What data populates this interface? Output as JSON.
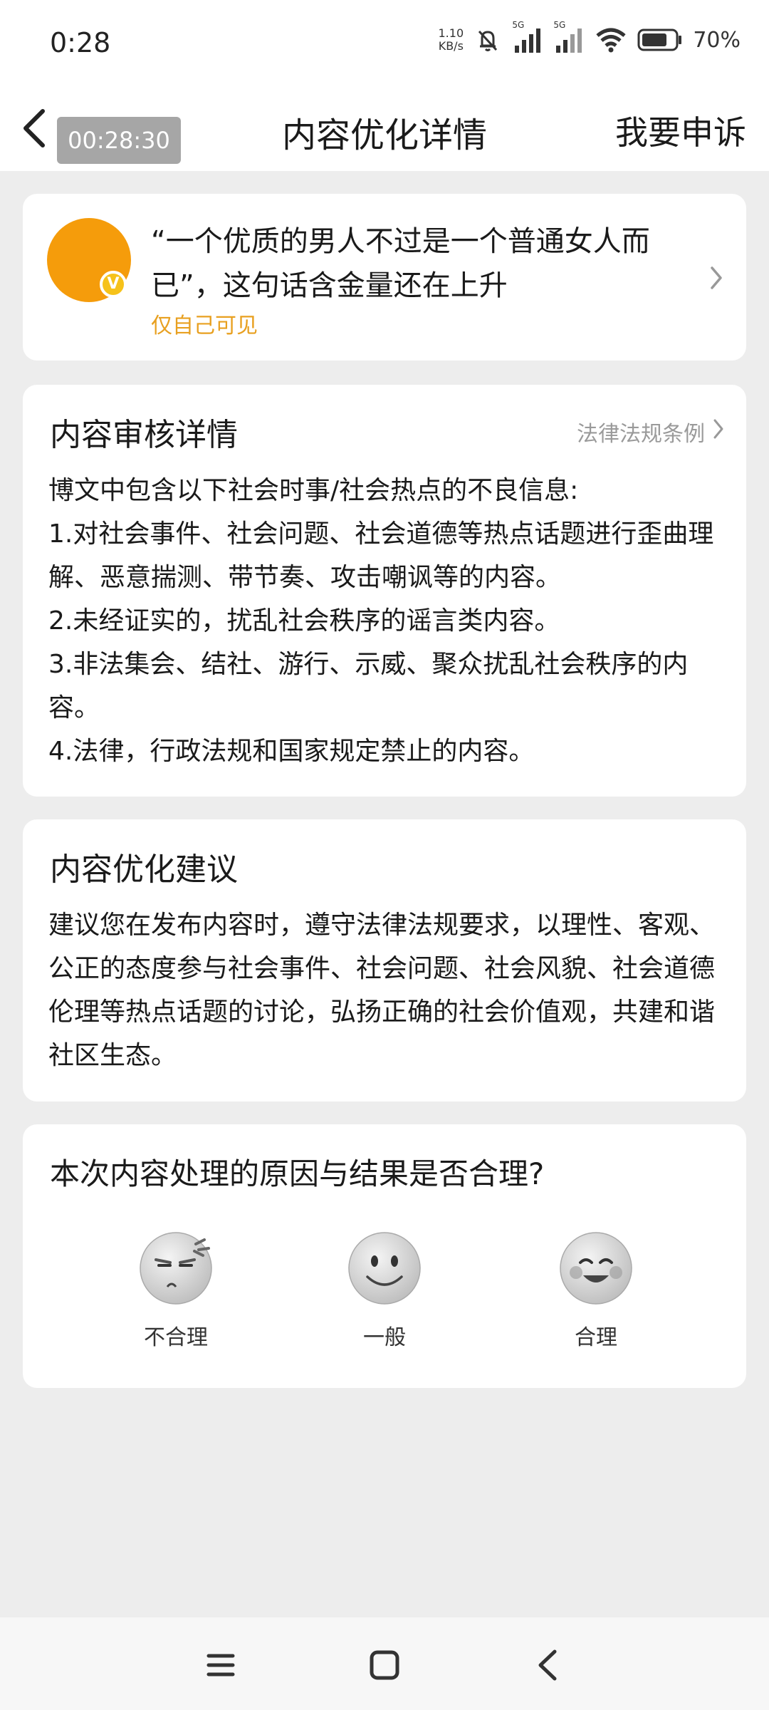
{
  "status_bar": {
    "time": "0:28",
    "net_speed_value": "1.10",
    "net_speed_unit": "KB/s",
    "signal1_label": "5G",
    "signal2_label": "5G",
    "battery_percent": "70%"
  },
  "header": {
    "timer": "00:28:30",
    "title": "内容优化详情",
    "appeal_label": "我要申诉",
    "back_icon": "chevron-left-icon"
  },
  "post": {
    "text": "“一个优质的男人不过是一个普通女人而已”，这句话含金量还在上升",
    "visibility": "仅自己可见",
    "avatar_color": "#f59c0b",
    "badge_text": "V"
  },
  "review": {
    "title": "内容审核详情",
    "law_link": "法律法规条例",
    "intro": "博文中包含以下社会时事/社会热点的不良信息:",
    "items": [
      "1.对社会事件、社会问题、社会道德等热点话题进行歪曲理解、恶意揣测、带节奏、攻击嘲讽等的内容。",
      "2.未经证实的，扰乱社会秩序的谣言类内容。",
      "3.非法集会、结社、游行、示威、聚众扰乱社会秩序的内容。",
      "4.法律，行政法规和国家规定禁止的内容。"
    ]
  },
  "suggestion": {
    "title": "内容优化建议",
    "body": "建议您在发布内容时，遵守法律法规要求，以理性、客观、公正的态度参与社会事件、社会问题、社会风貌、社会道德伦理等热点话题的讨论，弘扬正确的社会价值观，共建和谐社区生态。"
  },
  "feedback": {
    "question": "本次内容处理的原因与结果是否合理?",
    "options": [
      {
        "label": "不合理",
        "icon": "angry-face-icon"
      },
      {
        "label": "一般",
        "icon": "neutral-face-icon"
      },
      {
        "label": "合理",
        "icon": "happy-face-icon"
      }
    ]
  },
  "nav": {
    "menu_icon": "menu-icon",
    "home_icon": "home-icon",
    "back_icon": "back-icon"
  }
}
